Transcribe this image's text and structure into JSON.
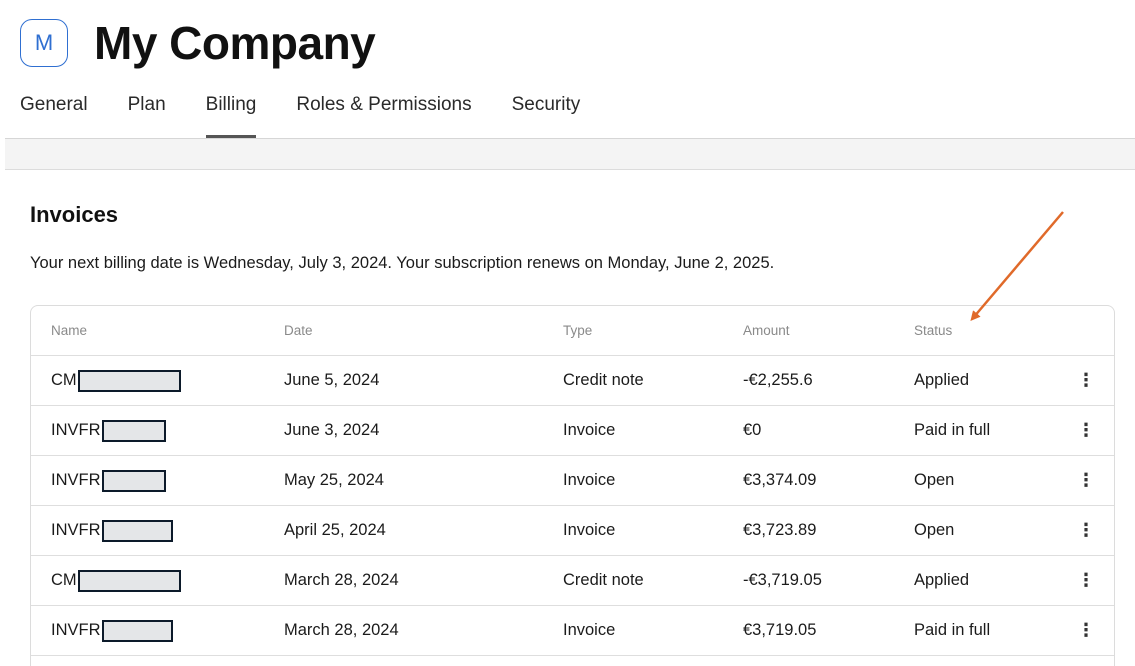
{
  "header": {
    "avatar_letter": "M",
    "company_name": "My Company"
  },
  "tabs": [
    {
      "label": "General",
      "active": false
    },
    {
      "label": "Plan",
      "active": false
    },
    {
      "label": "Billing",
      "active": true
    },
    {
      "label": "Roles & Permissions",
      "active": false
    },
    {
      "label": "Security",
      "active": false
    }
  ],
  "invoices": {
    "title": "Invoices",
    "note": "Your next billing date is Wednesday, July 3, 2024. Your subscription renews on Monday, June 2, 2025.",
    "columns": {
      "name": "Name",
      "date": "Date",
      "type": "Type",
      "amount": "Amount",
      "status": "Status"
    },
    "rows": [
      {
        "name_prefix": "CM",
        "date": "June 5, 2024",
        "type": "Credit note",
        "amount": "-€2,255.6",
        "status": "Applied",
        "menu": "⋮"
      },
      {
        "name_prefix": "INVFR",
        "date": "June 3, 2024",
        "type": "Invoice",
        "amount": "€0",
        "status": "Paid in full",
        "menu": "⋮"
      },
      {
        "name_prefix": "INVFR",
        "date": "May 25, 2024",
        "type": "Invoice",
        "amount": "€3,374.09",
        "status": "Open",
        "menu": "⋮"
      },
      {
        "name_prefix": "INVFR",
        "date": "April 25, 2024",
        "type": "Invoice",
        "amount": "€3,723.89",
        "status": "Open",
        "menu": "⋮"
      },
      {
        "name_prefix": "CM",
        "date": "March 28, 2024",
        "type": "Credit note",
        "amount": "-€3,719.05",
        "status": "Applied",
        "menu": "⋮"
      },
      {
        "name_prefix": "INVFR",
        "date": "March 28, 2024",
        "type": "Invoice",
        "amount": "€3,719.05",
        "status": "Paid in full",
        "menu": "⋮"
      }
    ]
  },
  "colors": {
    "accent": "#2f6fd1",
    "annotation_arrow": "#e06a2a",
    "redaction_border": "#0c1a2a"
  }
}
